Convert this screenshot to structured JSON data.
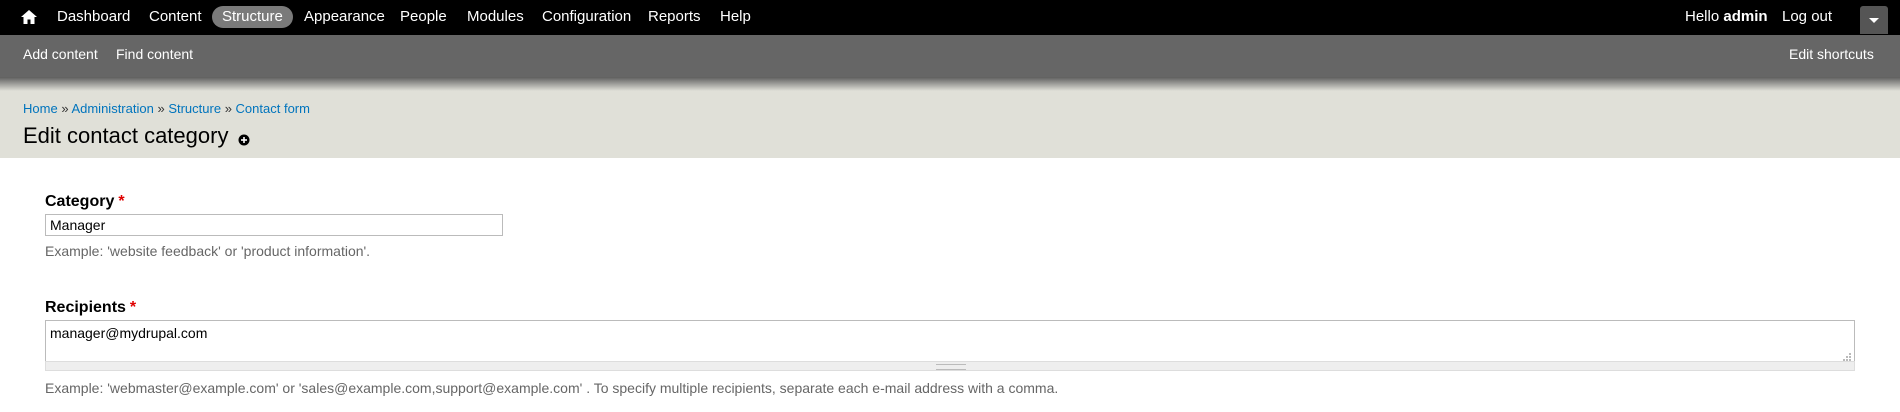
{
  "toolbar": {
    "home_icon": "home-icon",
    "menu": [
      {
        "label": "Dashboard"
      },
      {
        "label": "Content"
      },
      {
        "label": "Structure",
        "active": true
      },
      {
        "label": "Appearance"
      },
      {
        "label": "People"
      },
      {
        "label": "Modules"
      },
      {
        "label": "Configuration"
      },
      {
        "label": "Reports"
      },
      {
        "label": "Help"
      }
    ],
    "hello_prefix": "Hello",
    "username": "admin",
    "logout_label": "Log out",
    "drawer_icon": "chevron-down-icon"
  },
  "shortcuts": {
    "items": [
      {
        "label": "Add content"
      },
      {
        "label": "Find content"
      }
    ],
    "edit_label": "Edit shortcuts"
  },
  "breadcrumb": {
    "items": [
      {
        "label": "Home"
      },
      {
        "label": "Administration"
      },
      {
        "label": "Structure"
      },
      {
        "label": "Contact form"
      }
    ],
    "separator": "»"
  },
  "page": {
    "title": "Edit contact category",
    "add_shortcut_icon": "plus-circle-icon"
  },
  "form": {
    "category": {
      "label": "Category",
      "required_marker": "*",
      "value": "Manager",
      "description": "Example: 'website feedback' or 'product information'."
    },
    "recipients": {
      "label": "Recipients",
      "required_marker": "*",
      "value": "manager@mydrupal.com",
      "description": "Example: 'webmaster@example.com' or 'sales@example.com,support@example.com' . To specify multiple recipients, separate each e-mail address with a comma."
    }
  },
  "colors": {
    "toolbar_bg": "#000000",
    "shortcuts_bg": "#666666",
    "header_bg": "#e0e0d8",
    "link": "#0074bd",
    "required": "#e00000"
  }
}
